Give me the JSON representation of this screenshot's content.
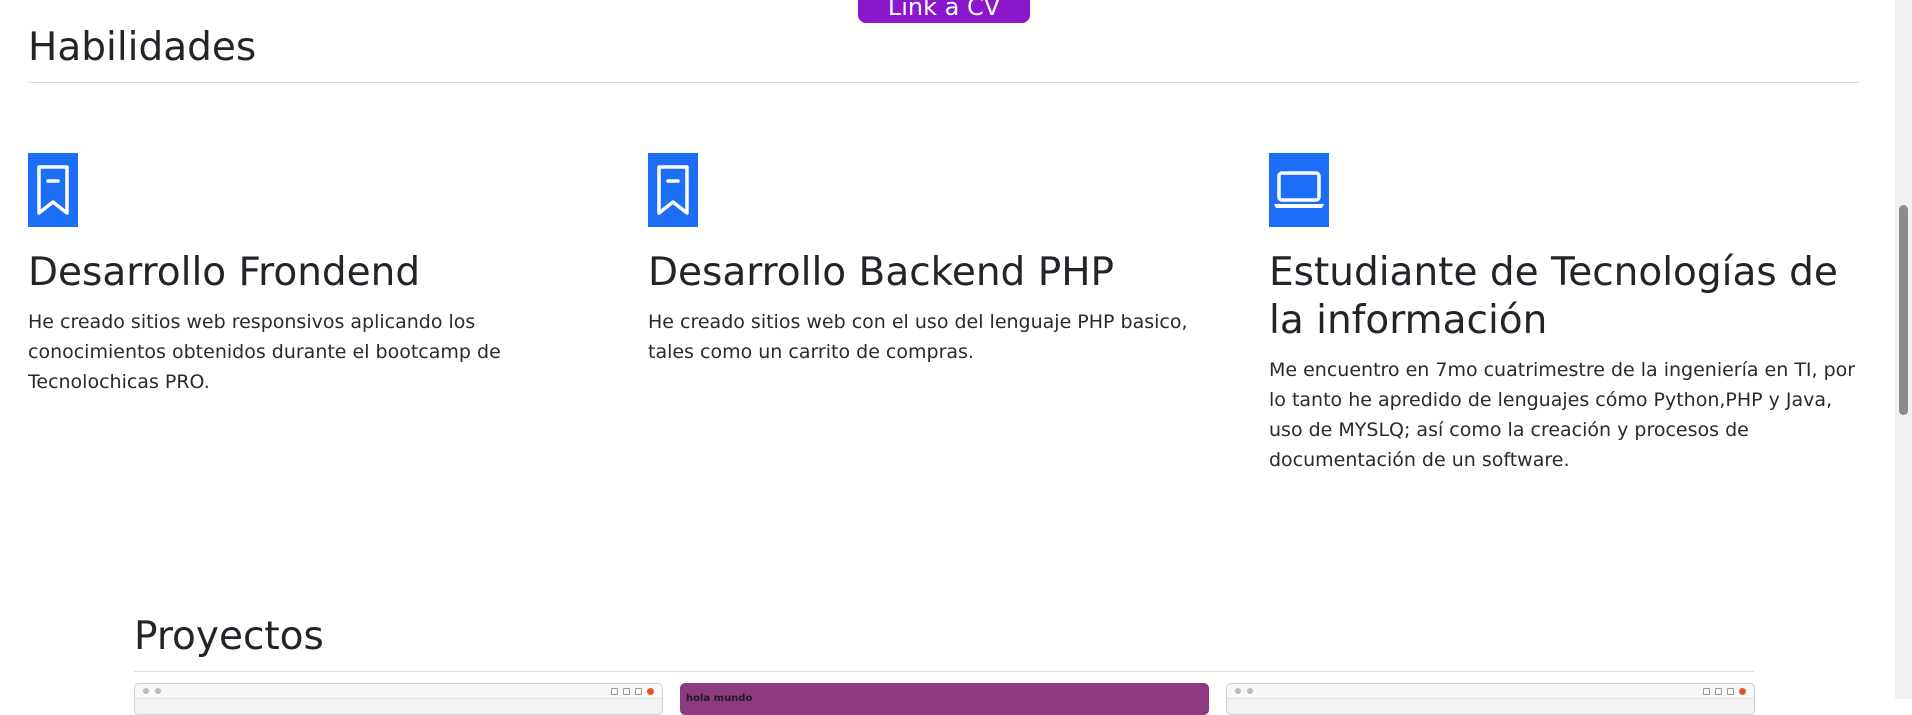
{
  "cv_button": {
    "label": "Link a CV"
  },
  "skills": {
    "title": "Habilidades",
    "items": [
      {
        "icon": "bookmark-icon",
        "title": "Desarrollo Frondend",
        "description": "He creado sitios web responsivos aplicando los conocimientos obtenidos durante el bootcamp de Tecnolochicas PRO."
      },
      {
        "icon": "bookmark-icon",
        "title": "Desarrollo Backend PHP",
        "description": "He creado sitios web con el uso del lenguaje PHP basico, tales como un carrito de compras."
      },
      {
        "icon": "laptop-icon",
        "title": "Estudiante de Tecnologías de la información",
        "description": "Me encuentro en 7mo cuatrimestre de la ingeniería en TI, por lo tanto he apredido de lenguajes cómo Python,PHP y Java, uso de MYSLQ; así como la creación y procesos de documentación de un software."
      }
    ]
  },
  "projects": {
    "title": "Proyectos",
    "thumbnails": [
      {
        "type": "browser-screenshot"
      },
      {
        "type": "colored-page",
        "text": "hola mundo",
        "color": "#8e3a80"
      },
      {
        "type": "browser-screenshot"
      }
    ]
  },
  "colors": {
    "accent": "#1b6ef5",
    "cv_button": "#8a17c9"
  }
}
